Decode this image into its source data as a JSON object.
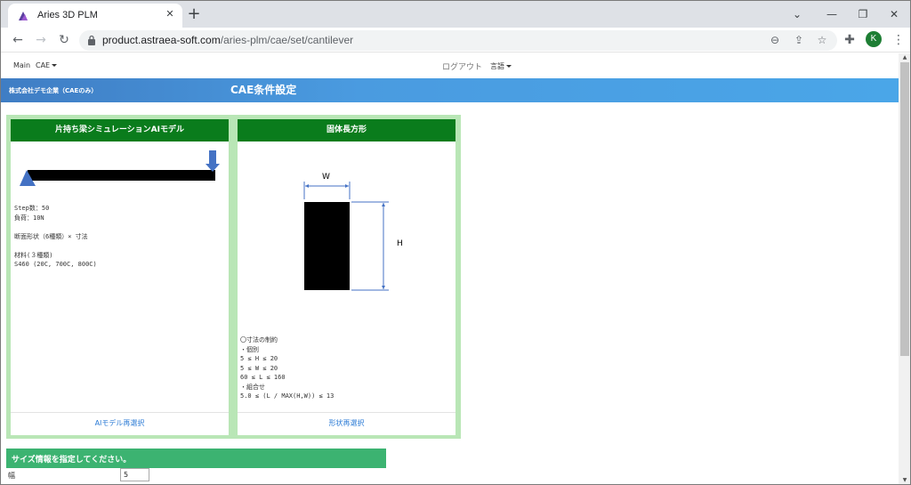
{
  "browser": {
    "tab_title": "Aries 3D PLM",
    "url_host": "product.astraea-soft.com",
    "url_path": "/aries-plm/cae/set/cantilever",
    "profile_initial": "K"
  },
  "nav": {
    "main": "Main",
    "cae": "CAE",
    "logout": "ログアウト",
    "language": "言語"
  },
  "banner": {
    "company": "株式会社デモ企業（CAEのみ）",
    "title": "CAE条件設定"
  },
  "model_card": {
    "header": "片持ち梁シミュレーションAIモデル",
    "info_lines": [
      "Step数：50",
      "負荷：10N",
      "",
      "断面形状（6種類）× 寸法",
      "",
      "材料(３種類)",
      "S460 (20C, 700C, 800C)"
    ],
    "footer_link": "AIモデル再選択"
  },
  "shape_card": {
    "header": "固体長方形",
    "width_label": "W",
    "height_label": "H",
    "constraint_lines": [
      "〇寸法の制約",
      "・個別",
      "5 ≤ H ≤ 20",
      "5 ≤ W ≤ 20",
      "60 ≤ L ≤ 160",
      "・組合せ",
      "5.0 ≤ (L / MAX(H,W)) ≤ 13"
    ],
    "footer_link": "形状再選択"
  },
  "size_section": {
    "title": "サイズ情報を指定してください。",
    "width_label": "幅",
    "width_value": "5"
  },
  "colors": {
    "banner": "#4a9be0",
    "card_header": "#0a7c1c",
    "card_frame": "#b9e6b6",
    "size_bar": "#3cb371",
    "link": "#2a7ad5",
    "beam_arrow": "#4472c4"
  }
}
